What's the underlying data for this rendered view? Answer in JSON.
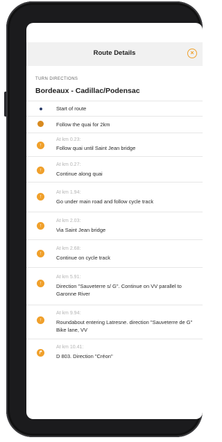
{
  "header": {
    "title": "Route Details",
    "close_glyph": "×"
  },
  "section_label": "TURN DIRECTIONS",
  "route_title": "Bordeaux - Cadillac/Podensac",
  "colors": {
    "accent": "#f0a02b",
    "start_dot": "#2c3e6b"
  },
  "directions": [
    {
      "km": "",
      "text": "Start of route",
      "icon": "start-dot-icon"
    },
    {
      "km": "",
      "text": "Follow the quai for 2km",
      "icon": "straight-icon"
    },
    {
      "km": "At km 0.23:",
      "text": "Follow quai until Saint Jean bridge",
      "icon": "turn-icon"
    },
    {
      "km": "At km 0.27:",
      "text": "Continue along quai",
      "icon": "turn-icon"
    },
    {
      "km": "At km 1.94:",
      "text": "Go under main road and follow cycle track",
      "icon": "turn-icon"
    },
    {
      "km": "At km 2.03:",
      "text": "Via Saint Jean bridge",
      "icon": "turn-icon"
    },
    {
      "km": "At km 2.68:",
      "text": "Continue on cycle track",
      "icon": "turn-icon"
    },
    {
      "km": "At km 5.91:",
      "text": "Direction \"Sauveterre s/ G\". Continue on VV parallel to Garonne River",
      "icon": "turn-icon"
    },
    {
      "km": "At km 9.94:",
      "text": "Roundabout entering Latresne. direction \"Sauveterre de G\" Bike lane, VV",
      "icon": "roundabout-icon"
    },
    {
      "km": "At km 10.41:",
      "text": "D 803. Direction \"Créon\"",
      "icon": "turn-right-icon"
    }
  ]
}
